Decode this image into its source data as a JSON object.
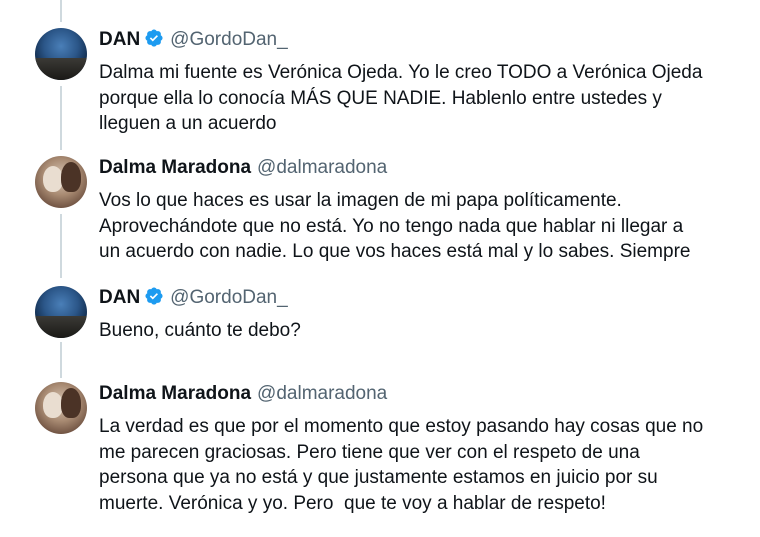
{
  "tweets": [
    {
      "name": "DAN",
      "handle": "@GordoDan_",
      "verified": true,
      "avatar": "dan-avatar",
      "text": "Dalma mi fuente es Verónica Ojeda. Yo le creo TODO a Verónica Ojeda\nporque ella lo conocía MÁS QUE NADIE. Hablenlo entre ustedes y\nlleguen a un acuerdo"
    },
    {
      "name": "Dalma Maradona",
      "handle": "@dalmaradona",
      "verified": false,
      "avatar": "dalma-avatar",
      "text": "Vos lo que haces es usar la imagen de mi papa políticamente.\nAprovechándote que no está. Yo no tengo nada que hablar ni llegar a\nun acuerdo con nadie. Lo que vos haces está mal y lo sabes. Siempre"
    },
    {
      "name": "DAN",
      "handle": "@GordoDan_",
      "verified": true,
      "avatar": "dan-avatar",
      "text": "Bueno, cuánto te debo?"
    },
    {
      "name": "Dalma Maradona",
      "handle": "@dalmaradona",
      "verified": false,
      "avatar": "dalma-avatar",
      "text": "La verdad es que por el momento que estoy pasando hay cosas que no\nme parecen graciosas. Pero tiene que ver con el respeto de una\npersona que ya no está y que justamente estamos en juicio por su\nmuerte. Verónica y yo. Pero  que te voy a hablar de respeto!"
    }
  ],
  "colors": {
    "text": "#0f1419",
    "handle": "#536471",
    "verified_badge": "#1d9bf0",
    "thread_line": "#cfd9de"
  }
}
